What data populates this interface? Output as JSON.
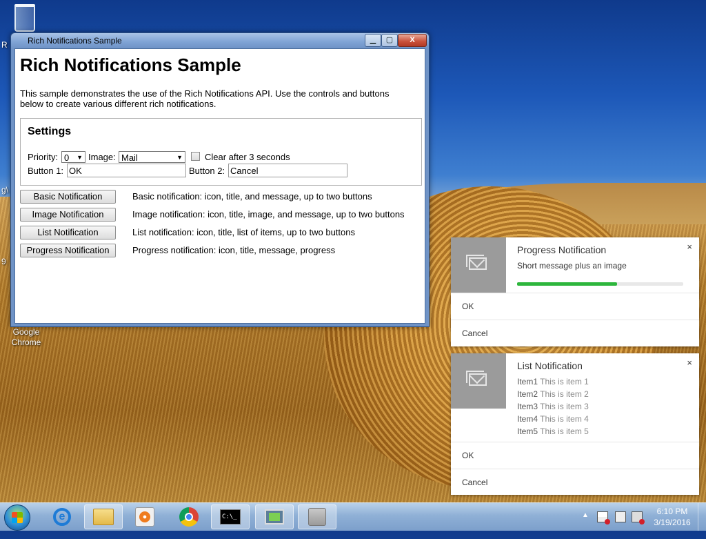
{
  "desktop": {
    "recycle_bin_label": "",
    "chrome_label": "Google Chrome",
    "edge_letters": [
      "R",
      "g\\",
      "9"
    ]
  },
  "window": {
    "title": "Rich Notifications Sample",
    "min_glyph": "▁",
    "max_glyph": "▢",
    "close_glyph": "X"
  },
  "page": {
    "heading": "Rich Notifications Sample",
    "description": "This sample demonstrates the use of the Rich Notifications API. Use the controls and buttons below to create various different rich notifications."
  },
  "settings": {
    "heading": "Settings",
    "priority_label": "Priority:",
    "priority_value": "0",
    "image_label": "Image:",
    "image_value": "Mail",
    "clear_label": "Clear after 3 seconds",
    "button1_label": "Button 1:",
    "button1_value": "OK",
    "button2_label": "Button 2:",
    "button2_value": "Cancel"
  },
  "actions": [
    {
      "label": "Basic Notification",
      "desc": "Basic notification: icon, title, and message, up to two buttons"
    },
    {
      "label": "Image Notification",
      "desc": "Image notification: icon, title, image, and message, up to two buttons"
    },
    {
      "label": "List Notification",
      "desc": "List notification: icon, title, list of items, up to two buttons"
    },
    {
      "label": "Progress Notification",
      "desc": "Progress notification: icon, title, message, progress"
    }
  ],
  "progress_notification": {
    "title": "Progress Notification",
    "message": "Short message plus an image",
    "progress_fraction": 0.6,
    "progress_color": "#2db63c",
    "close_glyph": "×",
    "button1": "OK",
    "button2": "Cancel"
  },
  "list_notification": {
    "title": "List Notification",
    "close_glyph": "×",
    "items": [
      {
        "title": "Item1",
        "message": "This is item 1"
      },
      {
        "title": "Item2",
        "message": "This is item 2"
      },
      {
        "title": "Item3",
        "message": "This is item 3"
      },
      {
        "title": "Item4",
        "message": "This is item 4"
      },
      {
        "title": "Item5",
        "message": "This is item 5"
      }
    ],
    "button1": "OK",
    "button2": "Cancel"
  },
  "taskbar": {
    "cmd_glyph": "C:\\_",
    "tray_up_glyph": "▲",
    "time": "6:10 PM",
    "date": "3/19/2016"
  }
}
